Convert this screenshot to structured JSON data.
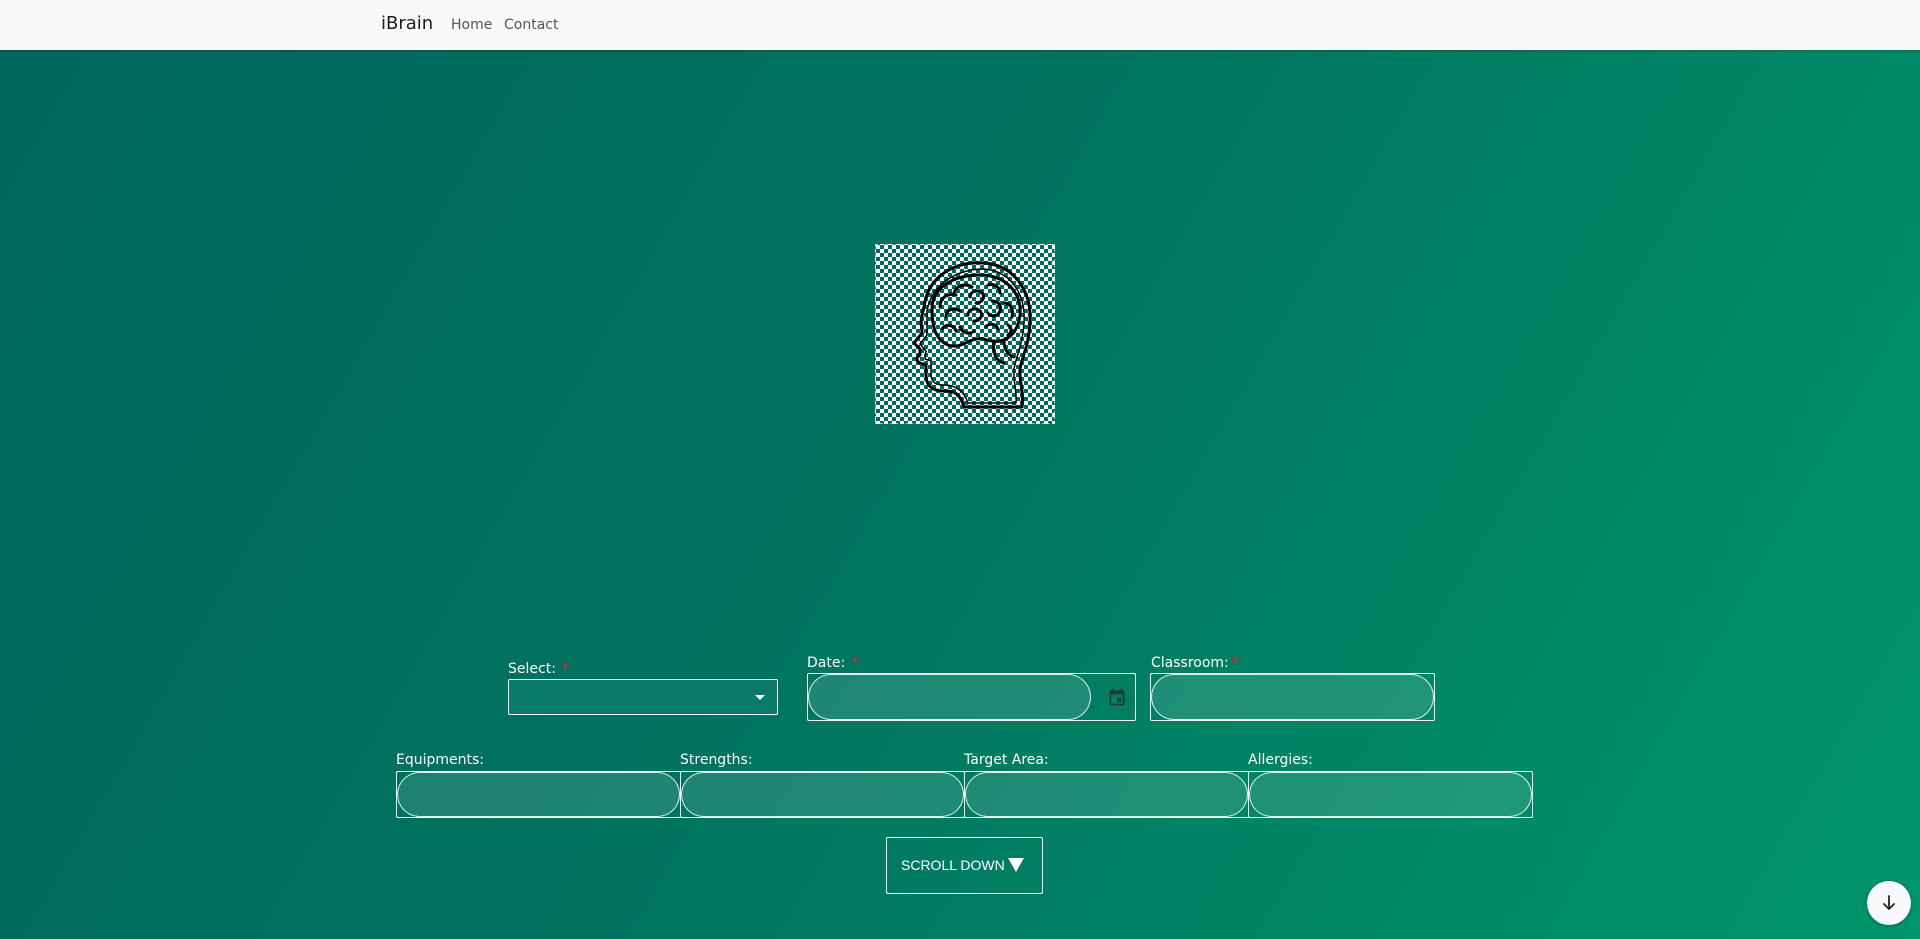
{
  "navbar": {
    "brand": "iBrain",
    "links": [
      {
        "label": "Home"
      },
      {
        "label": "Contact"
      }
    ]
  },
  "logo": {
    "icon": "human-head-brain-icon"
  },
  "form": {
    "select": {
      "label": "Select:",
      "required_mark": "*",
      "value": ""
    },
    "date": {
      "label": "Date:",
      "required_mark": "*",
      "value": "",
      "icon": "calendar-icon"
    },
    "classroom": {
      "label": "Classroom:",
      "required_mark": "*",
      "value": ""
    },
    "equipments": {
      "label": "Equipments:",
      "value": ""
    },
    "strengths": {
      "label": "Strengths:",
      "value": ""
    },
    "target_area": {
      "label": "Target Area:",
      "value": ""
    },
    "allergies": {
      "label": "Allergies:",
      "value": ""
    }
  },
  "scroll_button": {
    "label": "SCROLL DOWN",
    "icon": "triangle-down-icon"
  },
  "fab": {
    "icon": "arrow-down-icon"
  },
  "colors": {
    "background_start": "#00665e",
    "background_end": "#00956b",
    "navbar": "#f8f9fa",
    "required": "#e2262f"
  }
}
